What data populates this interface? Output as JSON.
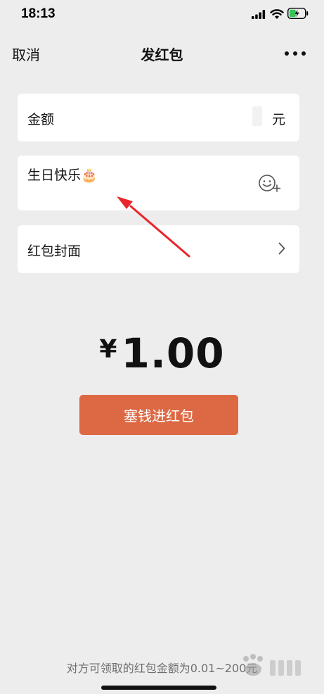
{
  "status_bar": {
    "time": "18:13"
  },
  "nav": {
    "cancel_label": "取消",
    "title": "发红包",
    "more_icon": "more-horizontal-icon"
  },
  "amount_field": {
    "label": "金额",
    "value": "",
    "unit": "元"
  },
  "greeting_field": {
    "value": "生日快乐🎂",
    "emoji_icon": "emoji-add-icon"
  },
  "cover_field": {
    "label": "红包封面",
    "chevron_icon": "chevron-right-icon"
  },
  "total": {
    "currency": "¥",
    "amount": "1.00"
  },
  "send_button_label": "塞钱进红包",
  "footer_note": "对方可领取的红包金额为0.01~200元",
  "colors": {
    "background": "#ededed",
    "card": "#ffffff",
    "send_button": "#dd6944",
    "annotation_arrow": "#e8262b"
  },
  "watermark_brand": "经验"
}
